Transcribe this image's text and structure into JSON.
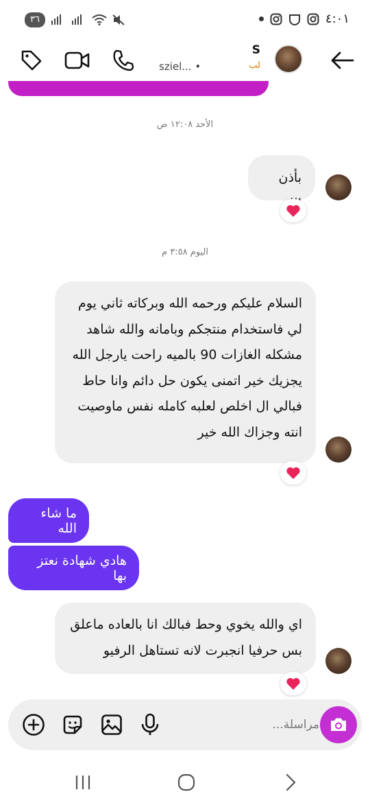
{
  "status_bar": {
    "battery": "٣٦",
    "time": "٤:٠١"
  },
  "header": {
    "contact_name": "S",
    "contact_subtitle": "لب",
    "username": "sziel... •"
  },
  "messages": [
    {
      "type": "timestamp",
      "text": "الأحد ١٢:٠٨ ص"
    },
    {
      "type": "incoming",
      "text": "بأذن الله",
      "reaction": "heart"
    },
    {
      "type": "timestamp",
      "text": "اليوم ٣:٥٨ م"
    },
    {
      "type": "incoming",
      "lines": [
        "السلام عليكم ورحمه الله وبركاته  ثاني يوم",
        "لي فاستخدام منتجكم وبامانه والله شاهد",
        "مشكله الغازات 90 بالميه راحت يارجل  الله",
        "يجزيك خير اتمنى يكون حل دائم وانا حاط",
        "فبالي ال اخلص لعلبه كامله نفس ماوصيت",
        "انته وجزاك الله خير"
      ],
      "reaction": "heart"
    },
    {
      "type": "outgoing",
      "text": "ما شاء الله"
    },
    {
      "type": "outgoing",
      "text": "هادي شهادة نعتز بها"
    },
    {
      "type": "incoming",
      "lines": [
        "اي والله يخوي وحط فبالك انا بالعاده ماعلق",
        "بس حرفيا انجبرت لانه تستاهل الرفيو"
      ],
      "reaction": "heart"
    }
  ],
  "composer": {
    "placeholder": "مراسلة..."
  },
  "colors": {
    "outgoing_bubble": "#6a34f0",
    "incoming_bubble": "#efefef",
    "camera_button": "#c32fd3",
    "heart": "#e8245a"
  }
}
